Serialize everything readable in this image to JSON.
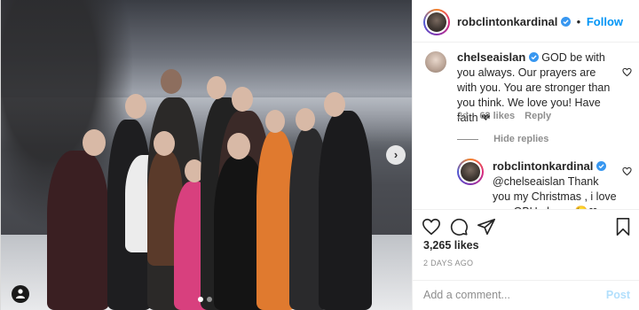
{
  "post": {
    "author": "robclintonkardinal",
    "follow_label": "Follow",
    "separator": "•"
  },
  "comment": {
    "username": "chelseaislan",
    "text": "GOD be with you always. Our prayers are with you. You are stronger than you think. We love you! Have faith ❤",
    "age": "2d",
    "likes": "62 likes",
    "reply_label": "Reply",
    "hide_replies_label": "Hide replies"
  },
  "reply": {
    "username": "robclintonkardinal",
    "text": "@chelseaislan Thank you my Christmas , i love you GBU always😘❤"
  },
  "footer": {
    "likes": "3,265 likes",
    "date": "2 DAYS AGO",
    "comment_placeholder": "Add a comment...",
    "post_label": "Post"
  },
  "colors": {
    "follow_blue": "#0095f6",
    "verified_blue": "#3897f0",
    "post_disabled": "#b2dffc"
  },
  "icons": [
    "user-tag-icon",
    "carousel-next-icon",
    "heart-icon",
    "comment-icon",
    "share-icon",
    "bookmark-icon",
    "verified-icon",
    "more-icon"
  ]
}
